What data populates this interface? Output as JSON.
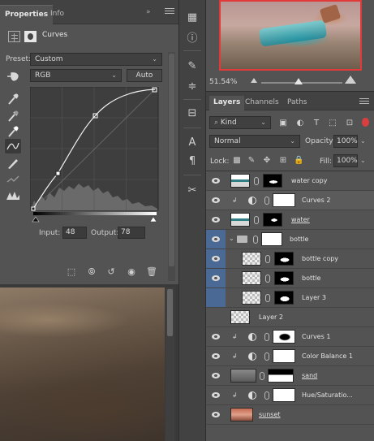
{
  "properties": {
    "tabs": [
      "Properties",
      "Info"
    ],
    "menu_glyph": "»",
    "title": "Curves",
    "preset_label": "Preset:",
    "preset_value": "Custom",
    "channel_value": "RGB",
    "auto_label": "Auto",
    "input_label": "Input:",
    "input_value": "48",
    "output_label": "Output:",
    "output_value": "78"
  },
  "navigator": {
    "zoom": "51.54%"
  },
  "layers": {
    "tabs": [
      "Layers",
      "Channels",
      "Paths"
    ],
    "kind_filter": "Kind",
    "blend_mode": "Normal",
    "opacity_label": "Opacity:",
    "opacity_value": "100%",
    "lock_label": "Lock:",
    "fill_label": "Fill:",
    "fill_value": "100%",
    "rows": [
      {
        "name": "water copy"
      },
      {
        "name": "Curves 2"
      },
      {
        "name": "water"
      },
      {
        "name": "bottle"
      },
      {
        "name": "bottle copy"
      },
      {
        "name": "bottle"
      },
      {
        "name": "Layer 3"
      },
      {
        "name": "Layer 2"
      },
      {
        "name": "Curves 1"
      },
      {
        "name": "Color Balance 1"
      },
      {
        "name": "sand"
      },
      {
        "name": "Hue/Saturatio..."
      },
      {
        "name": "sunset"
      }
    ]
  },
  "colors": {
    "panel_bg": "#535353",
    "selection_blue": "#4a6a95",
    "navigator_border": "#e03a3a",
    "filter_toggle": "#d84040"
  },
  "icons": {
    "properties_header": [
      "adjustment-icon",
      "mask-icon"
    ],
    "curve_tools": [
      "sample-image-icon",
      "eyedropper-black-icon",
      "eyedropper-gray-icon",
      "eyedropper-white-icon",
      "edit-points-icon",
      "pencil-draw-icon",
      "smooth-curve-icon",
      "clipping-warning-icon"
    ],
    "properties_bottom": [
      "clip-to-layer-icon",
      "view-previous-icon",
      "reset-icon",
      "visibility-icon",
      "delete-icon"
    ],
    "strip": [
      "histogram-icon",
      "info-icon",
      "brush-presets-icon",
      "adjustments-icon",
      "clone-source-icon",
      "character-icon",
      "paragraph-icon",
      "tool-presets-icon"
    ],
    "layer_filters": [
      "pixel-filter-icon",
      "adjustment-filter-icon",
      "type-filter-icon",
      "shape-filter-icon",
      "smart-object-filter-icon"
    ],
    "locks": [
      "lock-transparent-icon",
      "lock-image-icon",
      "lock-position-icon",
      "lock-artboard-icon",
      "lock-all-icon"
    ]
  }
}
